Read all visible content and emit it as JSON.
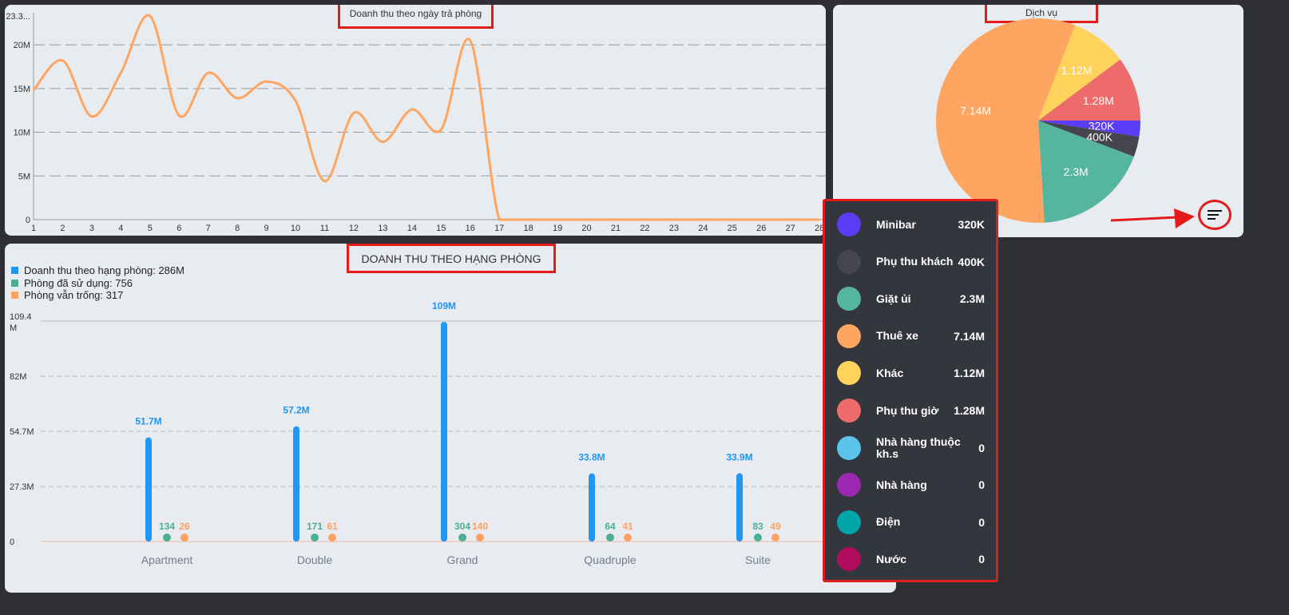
{
  "line_panel": {
    "title": "Doanh thu theo ngày trả phòng"
  },
  "pie_panel": {
    "title": "Dịch vụ"
  },
  "bar_panel": {
    "title": "DOANH THU THEO HẠNG PHÒNG",
    "legend": [
      {
        "label": "Doanh thu theo hạng phòng: 286M",
        "color": "#2196f3"
      },
      {
        "label": "Phòng đã sử dụng: 756",
        "color": "#4caf8f"
      },
      {
        "label": "Phòng vẫn trống: 317",
        "color": "#ffa160"
      }
    ]
  },
  "popup": {
    "items": [
      {
        "label": "Minibar",
        "value": "320K",
        "color": "#5b3cf5"
      },
      {
        "label": "Phụ thu khách",
        "value": "400K",
        "color": "#45464d"
      },
      {
        "label": "Giặt ủi",
        "value": "2.3M",
        "color": "#55b59f"
      },
      {
        "label": "Thuê xe",
        "value": "7.14M",
        "color": "#ffa562"
      },
      {
        "label": "Khác",
        "value": "1.12M",
        "color": "#ffd25c"
      },
      {
        "label": "Phụ thu giờ",
        "value": "1.28M",
        "color": "#ee6b6b"
      },
      {
        "label": "Nhà hàng thuộc kh.s",
        "value": "0",
        "color": "#5cc4ea"
      },
      {
        "label": "Nhà hàng",
        "value": "0",
        "color": "#9c27b0"
      },
      {
        "label": "Điện",
        "value": "0",
        "color": "#00a5a8"
      },
      {
        "label": "Nước",
        "value": "0",
        "color": "#b00c5c"
      }
    ]
  },
  "chart_data": [
    {
      "type": "line",
      "title": "Doanh thu theo ngày trả phòng",
      "x": [
        "1",
        "2",
        "3",
        "4",
        "5",
        "6",
        "7",
        "8",
        "9",
        "10",
        "11",
        "12",
        "13",
        "14",
        "15",
        "16",
        "17",
        "18",
        "19",
        "20",
        "21",
        "22",
        "23",
        "24",
        "25",
        "26",
        "27",
        "28"
      ],
      "y": [
        14.8,
        18.2,
        11.8,
        16.8,
        23.3,
        11.9,
        16.8,
        13.9,
        15.8,
        13.6,
        4.4,
        12.2,
        8.9,
        12.6,
        10.3,
        20.5,
        0,
        0,
        0,
        0,
        0,
        0,
        0,
        0,
        0,
        0,
        0,
        0
      ],
      "ylim": [
        0,
        23.3
      ],
      "yticks": [
        "0",
        "5M",
        "10M",
        "15M",
        "20M",
        "23.3..."
      ],
      "ytick_values": [
        0,
        5,
        10,
        15,
        20,
        23.3
      ],
      "color": "#ffa562",
      "grid": true
    },
    {
      "type": "pie",
      "title": "Dịch vụ",
      "labels": [
        "Minibar",
        "Phụ thu khách",
        "Giặt ủi",
        "Thuê xe",
        "Khác",
        "Phụ thu giờ"
      ],
      "values": [
        0.32,
        0.4,
        2.3,
        7.14,
        1.12,
        1.28
      ],
      "value_labels": [
        "320K",
        "400K",
        "2.3M",
        "7.14M",
        "1.12M",
        "1.28M"
      ],
      "colors": [
        "#5b3cf5",
        "#45464d",
        "#55b59f",
        "#ffa562",
        "#ffd25c",
        "#ee6b6b"
      ]
    },
    {
      "type": "bar",
      "title": "DOANH THU THEO HẠNG PHÒNG",
      "categories": [
        "Apartment",
        "Double",
        "Grand",
        "Quadruple",
        "Suite"
      ],
      "series": [
        {
          "name": "Doanh thu theo hạng phòng",
          "values": [
            51.7,
            57.2,
            109,
            33.8,
            33.9
          ],
          "labels": [
            "51.7M",
            "57.2M",
            "109M",
            "33.8M",
            "33.9M"
          ],
          "color": "#2196f3"
        },
        {
          "name": "Phòng đã sử dụng",
          "values": [
            134,
            171,
            304,
            64,
            83
          ],
          "labels": [
            "134",
            "171",
            "304",
            "64",
            "83"
          ],
          "color": "#4caf8f"
        },
        {
          "name": "Phòng vẫn trống",
          "values": [
            26,
            61,
            140,
            41,
            49
          ],
          "labels": [
            "26",
            "61",
            "140",
            "41",
            "49"
          ],
          "color": "#ffa160"
        }
      ],
      "ylim": [
        0,
        109.4
      ],
      "yticks": [
        "0",
        "27.3M",
        "54.7M",
        "82M",
        "109.4 M"
      ],
      "ytick_values": [
        0,
        27.3,
        54.7,
        82,
        109.4
      ],
      "grid": true
    }
  ]
}
